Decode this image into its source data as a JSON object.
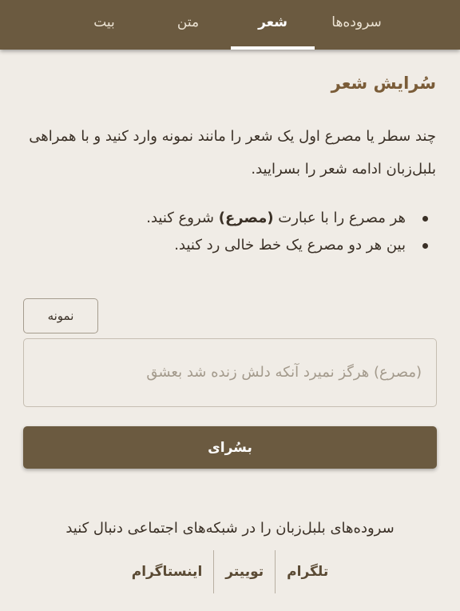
{
  "nav": {
    "tabs": [
      {
        "label": "سروده‌ها",
        "active": false
      },
      {
        "label": "شعر",
        "active": true
      },
      {
        "label": "متن",
        "active": false
      },
      {
        "label": "بیت",
        "active": false
      }
    ]
  },
  "main": {
    "title": "سُرایش شعر",
    "intro": "چند سطر یا مصرع اول یک شعر را مانند نمونه وارد کنید و با همراهی بلبل‌زبان ادامه شعر را بسرایید.",
    "rules": [
      {
        "before": "هر مصرع را با عبارت ",
        "bold": "(مصرع)",
        "after": " شروع کنید."
      },
      {
        "text": "بین هر دو مصرع یک خط خالی رد کنید."
      }
    ],
    "sample_button": "نمونه",
    "input_placeholder": "(مصرع) هرگز نمیرد آنکه دلش زنده شد بعشق",
    "input_value": "",
    "compose_button": "بسُرای"
  },
  "footer": {
    "follow_text": "سروده‌های بلبل‌زبان را در شبکه‌های اجتماعی دنبال کنید",
    "social": [
      "تلگرام",
      "توییتر",
      "اینستاگرام"
    ]
  },
  "colors": {
    "nav_bg": "#6b5a40",
    "page_bg": "#f0ece6",
    "heading": "#7a5c38",
    "button_bg": "#6b5a40"
  }
}
